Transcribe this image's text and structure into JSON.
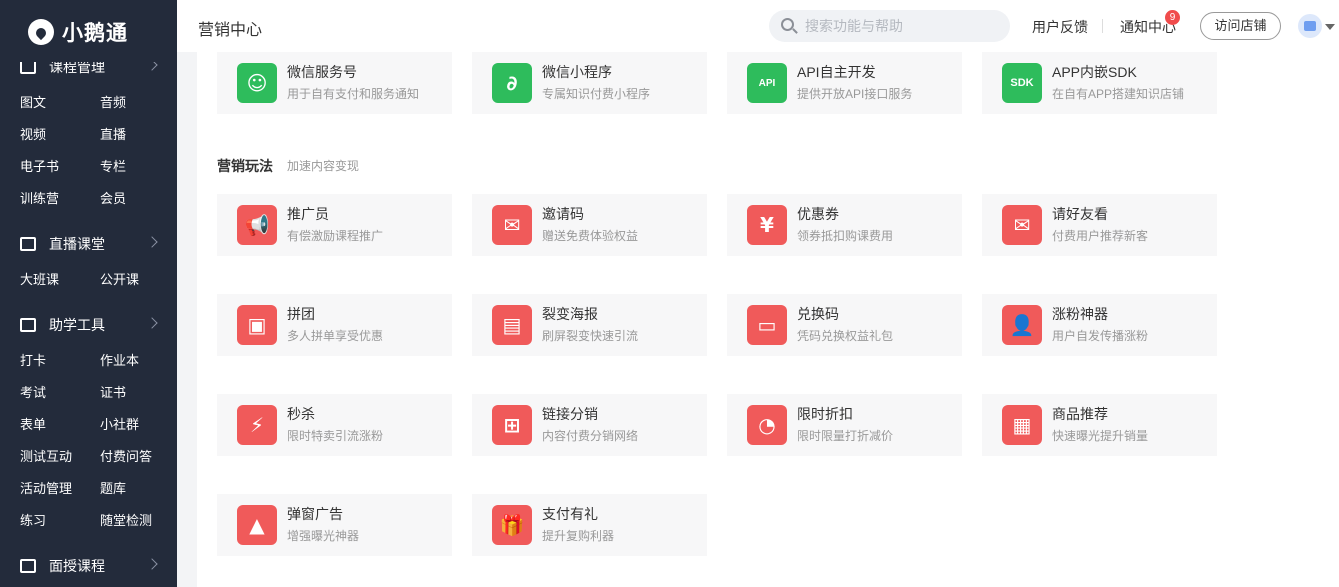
{
  "brand": {
    "name": "小鹅通"
  },
  "sidebar": {
    "categories": [
      {
        "label": "课程管理",
        "icon": "course-icon"
      },
      {
        "label": "直播课堂",
        "icon": "video-camera-icon"
      },
      {
        "label": "助学工具",
        "icon": "toolbox-icon"
      },
      {
        "label": "面授课程",
        "icon": "classroom-icon"
      }
    ],
    "items": [
      "图文",
      "音频",
      "视频",
      "直播",
      "电子书",
      "专栏",
      "训练营",
      "会员",
      "大班课",
      "公开课",
      "打卡",
      "作业本",
      "考试",
      "证书",
      "表单",
      "小社群",
      "测试互动",
      "付费问答",
      "活动管理",
      "题库",
      "练习",
      "随堂检测"
    ]
  },
  "header": {
    "title": "营销中心",
    "search_placeholder": "搜索功能与帮助",
    "feedback": "用户反馈",
    "notifications": "通知中心",
    "notification_count": "9",
    "visit_store": "访问店铺"
  },
  "top_cards": [
    {
      "name": "微信服务号",
      "desc": "用于自有支付和服务通知",
      "icon": "wechat-service-icon"
    },
    {
      "name": "微信小程序",
      "desc": "专属知识付费小程序",
      "icon": "mini-program-icon"
    },
    {
      "name": "API自主开发",
      "desc": "提供开放API接口服务",
      "icon": "api-icon"
    },
    {
      "name": "APP内嵌SDK",
      "desc": "在自有APP搭建知识店铺",
      "icon": "sdk-icon"
    }
  ],
  "marketing": {
    "title": "营销玩法",
    "subtitle": "加速内容变现",
    "cards": [
      {
        "name": "推广员",
        "desc": "有偿激励课程推广",
        "icon": "megaphone-icon"
      },
      {
        "name": "邀请码",
        "desc": "赠送免费体验权益",
        "icon": "invite-envelope-icon"
      },
      {
        "name": "优惠券",
        "desc": "领券抵扣购课费用",
        "icon": "coupon-icon"
      },
      {
        "name": "请好友看",
        "desc": "付费用户推荐新客",
        "icon": "gift-envelope-icon"
      },
      {
        "name": "拼团",
        "desc": "多人拼单享受优惠",
        "icon": "group-buy-icon"
      },
      {
        "name": "裂变海报",
        "desc": "刷屏裂变快速引流",
        "icon": "poster-icon"
      },
      {
        "name": "兑换码",
        "desc": "凭码兑换权益礼包",
        "icon": "redeem-code-icon"
      },
      {
        "name": "涨粉神器",
        "desc": "用户自发传播涨粉",
        "icon": "add-follower-icon"
      },
      {
        "name": "秒杀",
        "desc": "限时特卖引流涨粉",
        "icon": "lightning-icon"
      },
      {
        "name": "链接分销",
        "desc": "内容付费分销网络",
        "icon": "distribution-icon"
      },
      {
        "name": "限时折扣",
        "desc": "限时限量打折减价",
        "icon": "clock-icon"
      },
      {
        "name": "商品推荐",
        "desc": "快速曝光提升销量",
        "icon": "recommend-grid-icon"
      },
      {
        "name": "弹窗广告",
        "desc": "增强曝光神器",
        "icon": "popup-ad-icon"
      },
      {
        "name": "支付有礼",
        "desc": "提升复购利器",
        "icon": "gift-box-icon"
      }
    ]
  },
  "colors": {
    "sidebar": "#232b3b",
    "green": "#2ebc5c",
    "red": "#f05a5a"
  }
}
